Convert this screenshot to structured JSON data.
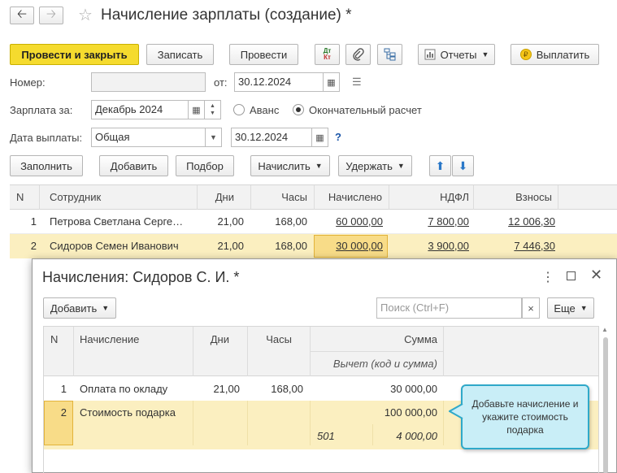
{
  "title": "Начисление зарплаты (создание) *",
  "toolbar": {
    "post_close": "Провести и закрыть",
    "save": "Записать",
    "post": "Провести",
    "dt_kt": "Дт Кт",
    "reports": "Отчеты",
    "pay": "Выплатить"
  },
  "form": {
    "number_label": "Номер:",
    "number_value": "",
    "from_label": "от:",
    "date_value": "30.12.2024",
    "salary_for_label": "Зарплата за:",
    "salary_for_value": "Декабрь 2024",
    "advance_label": "Аванс",
    "final_label": "Окончательный расчет",
    "pay_date_label": "Дата выплаты:",
    "pay_date_type": "Общая",
    "pay_date_value": "30.12.2024",
    "help": "?"
  },
  "actions": {
    "fill": "Заполнить",
    "add": "Добавить",
    "select": "Подбор",
    "accrue": "Начислить",
    "withhold": "Удержать"
  },
  "main_table": {
    "headers": [
      "N",
      "Сотрудник",
      "Дни",
      "Часы",
      "Начислено",
      "НДФЛ",
      "Взносы"
    ],
    "rows": [
      {
        "n": "1",
        "employee": "Петрова Светлана Серге…",
        "days": "21,00",
        "hours": "168,00",
        "accrued": "60 000,00",
        "ndfl": "7 800,00",
        "contrib": "12 006,30"
      },
      {
        "n": "2",
        "employee": "Сидоров Семен Иванович",
        "days": "21,00",
        "hours": "168,00",
        "accrued": "30 000,00",
        "ndfl": "3 900,00",
        "contrib": "7 446,30"
      }
    ]
  },
  "dialog": {
    "title": "Начисления: Сидоров С. И. *",
    "add": "Добавить",
    "search_placeholder": "Поиск (Ctrl+F)",
    "clear": "×",
    "more": "Еще",
    "headers": {
      "n": "N",
      "accrual": "Начисление",
      "days": "Дни",
      "hours": "Часы",
      "sum": "Сумма",
      "deduction": "Вычет (код и сумма)"
    },
    "rows": [
      {
        "n": "1",
        "accrual": "Оплата по окладу",
        "days": "21,00",
        "hours": "168,00",
        "sum": "30 000,00",
        "ded_code": "",
        "ded_sum": ""
      },
      {
        "n": "2",
        "accrual": "Стоимость подарка",
        "days": "",
        "hours": "",
        "sum": "100 000,00",
        "ded_code": "501",
        "ded_sum": "4 000,00"
      }
    ],
    "tooltip": "Добавьте начисление и укажите стоимость подарка"
  },
  "colors": {
    "accent_yellow": "#f5db2e",
    "selected_row": "#fbefc0",
    "link": "#1a55a8",
    "tooltip_bg": "#c9eef7",
    "tooltip_border": "#2fa9c9"
  }
}
